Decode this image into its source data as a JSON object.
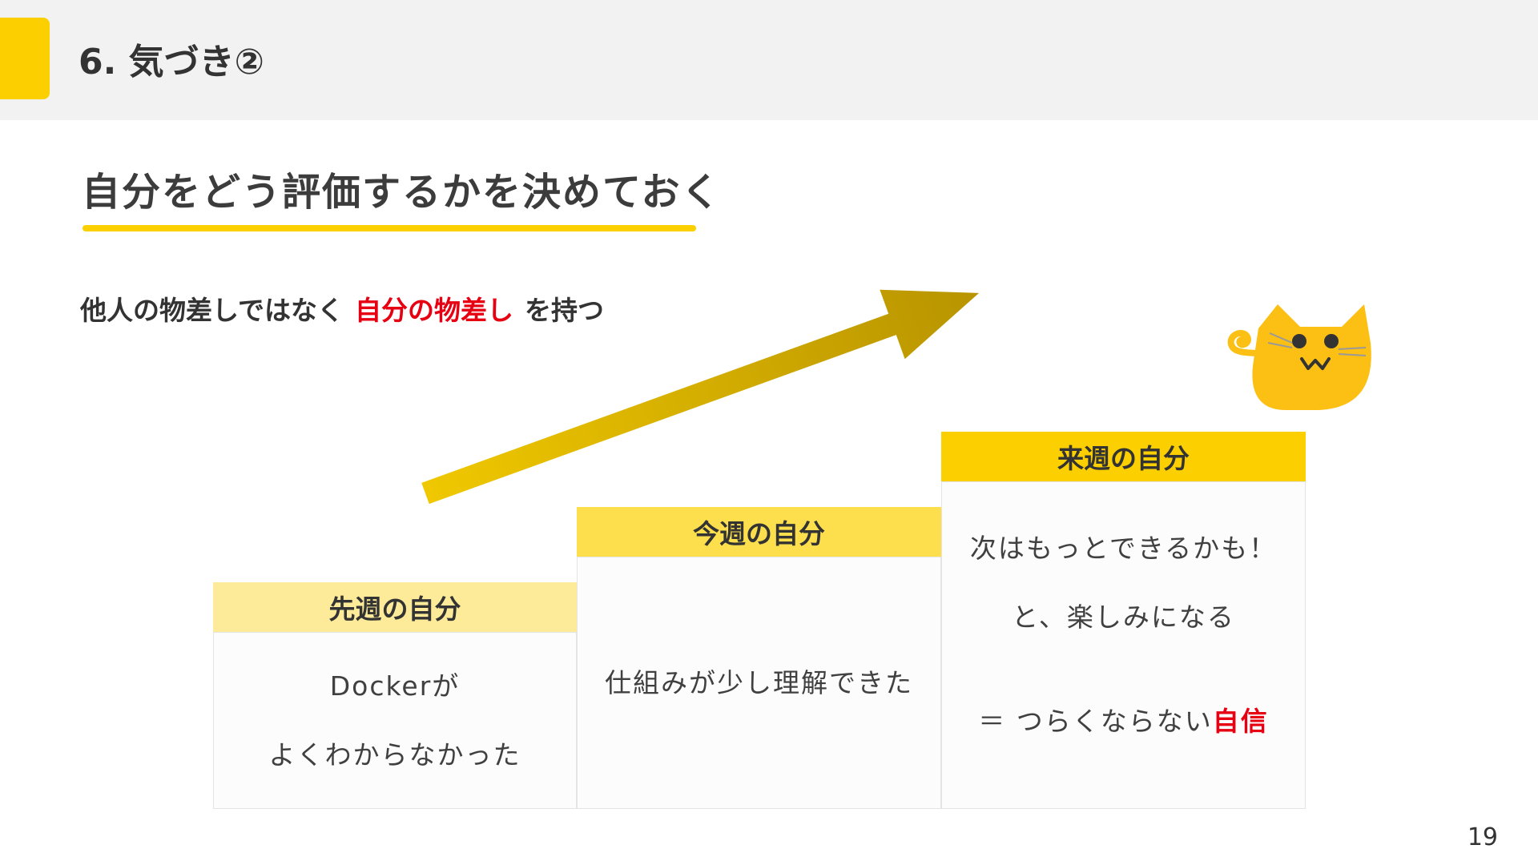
{
  "header": {
    "title": "6. 気づき②"
  },
  "subtitle": "自分をどう評価するかを決めておく",
  "statement": {
    "before": "他人の物差しではなく",
    "highlight": "自分の物差し",
    "after": "を持つ"
  },
  "steps": [
    {
      "heading": "先週の自分",
      "lines": [
        "Dockerが",
        "よくわからなかった"
      ]
    },
    {
      "heading": "今週の自分",
      "lines": [
        "仕組みが少し理解できた"
      ]
    },
    {
      "heading": "来週の自分",
      "lines": [
        "次はもっとできるかも！",
        "と、楽しみになる"
      ],
      "conclusion_prefix": "＝ つらくならない",
      "conclusion_highlight": "自信"
    }
  ],
  "page_number": "19",
  "colors": {
    "accent_yellow": "#fcd000",
    "highlight_red": "#e60012",
    "header_bg": "#f2f2f2"
  }
}
